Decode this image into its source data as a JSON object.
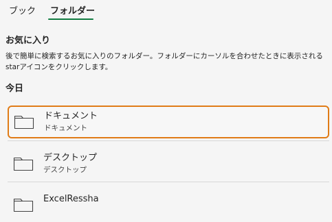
{
  "tabs": {
    "book_label": "ブック",
    "folder_label": "フォルダー",
    "active": "folder"
  },
  "favorites": {
    "title": "お気に入り",
    "description": "後で簡単に検索するお気に入りのフォルダー。フォルダーにカーソルを合わせたときに表示されるstarアイコンをクリックします。"
  },
  "today": {
    "title": "今日",
    "items": [
      {
        "name": "ドキュメント",
        "path": "ドキュメント",
        "icon": "folder-icon",
        "selected": true
      },
      {
        "name": "デスクトップ",
        "path": "デスクトップ",
        "icon": "folder-icon",
        "selected": false
      },
      {
        "name": "ExcelRessha",
        "path": "",
        "icon": "folder-icon",
        "selected": false
      }
    ]
  },
  "colors": {
    "accent": "#107c41",
    "selection_border": "#e07b16",
    "background": "#f5f5f5"
  }
}
